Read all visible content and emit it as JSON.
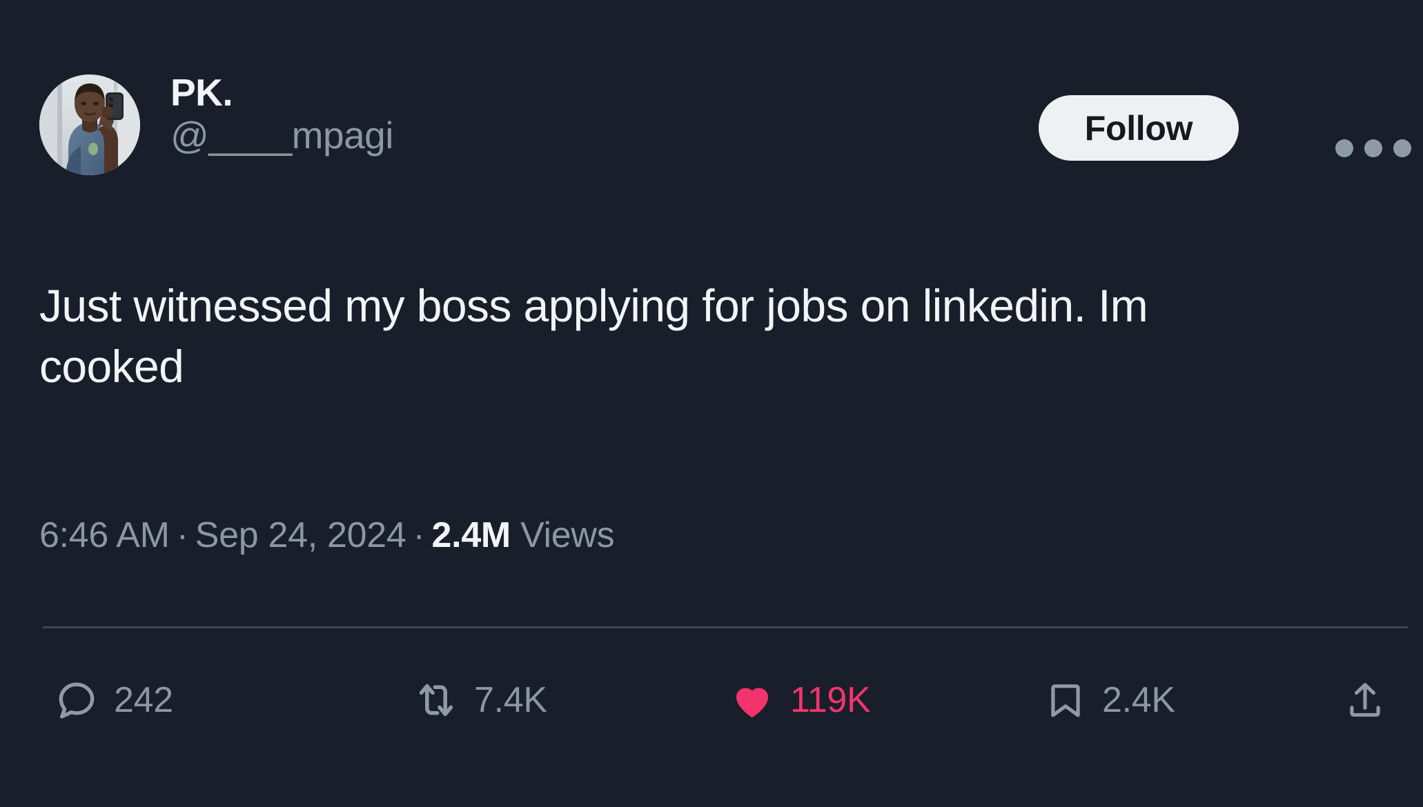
{
  "theme": {
    "background": "#191f2a",
    "text_primary": "#f2f5f7",
    "text_secondary": "#8a97a5",
    "divider": "#3d4757",
    "like_accent": "#f4336d",
    "follow_button_bg": "#eef1f4",
    "follow_button_text": "#15191f"
  },
  "post": {
    "author": {
      "display_name": "PK.",
      "handle": "@____mpagi",
      "avatar_alt": "profile-photo"
    },
    "follow_label": "Follow",
    "more_options_label": "•••",
    "body": "Just witnessed my boss applying for jobs on linkedin. Im  cooked",
    "meta": {
      "time": "6:46 AM",
      "separator": "·",
      "date": "Sep 24, 2024",
      "views_count": "2.4M",
      "views_label": "Views"
    },
    "actions": {
      "reply": {
        "icon": "reply-icon",
        "count": "242"
      },
      "retweet": {
        "icon": "retweet-icon",
        "count": "7.4K"
      },
      "like": {
        "icon": "heart-icon",
        "count": "119K"
      },
      "bookmark": {
        "icon": "bookmark-icon",
        "count": "2.4K"
      },
      "share": {
        "icon": "share-icon",
        "count": ""
      }
    }
  }
}
